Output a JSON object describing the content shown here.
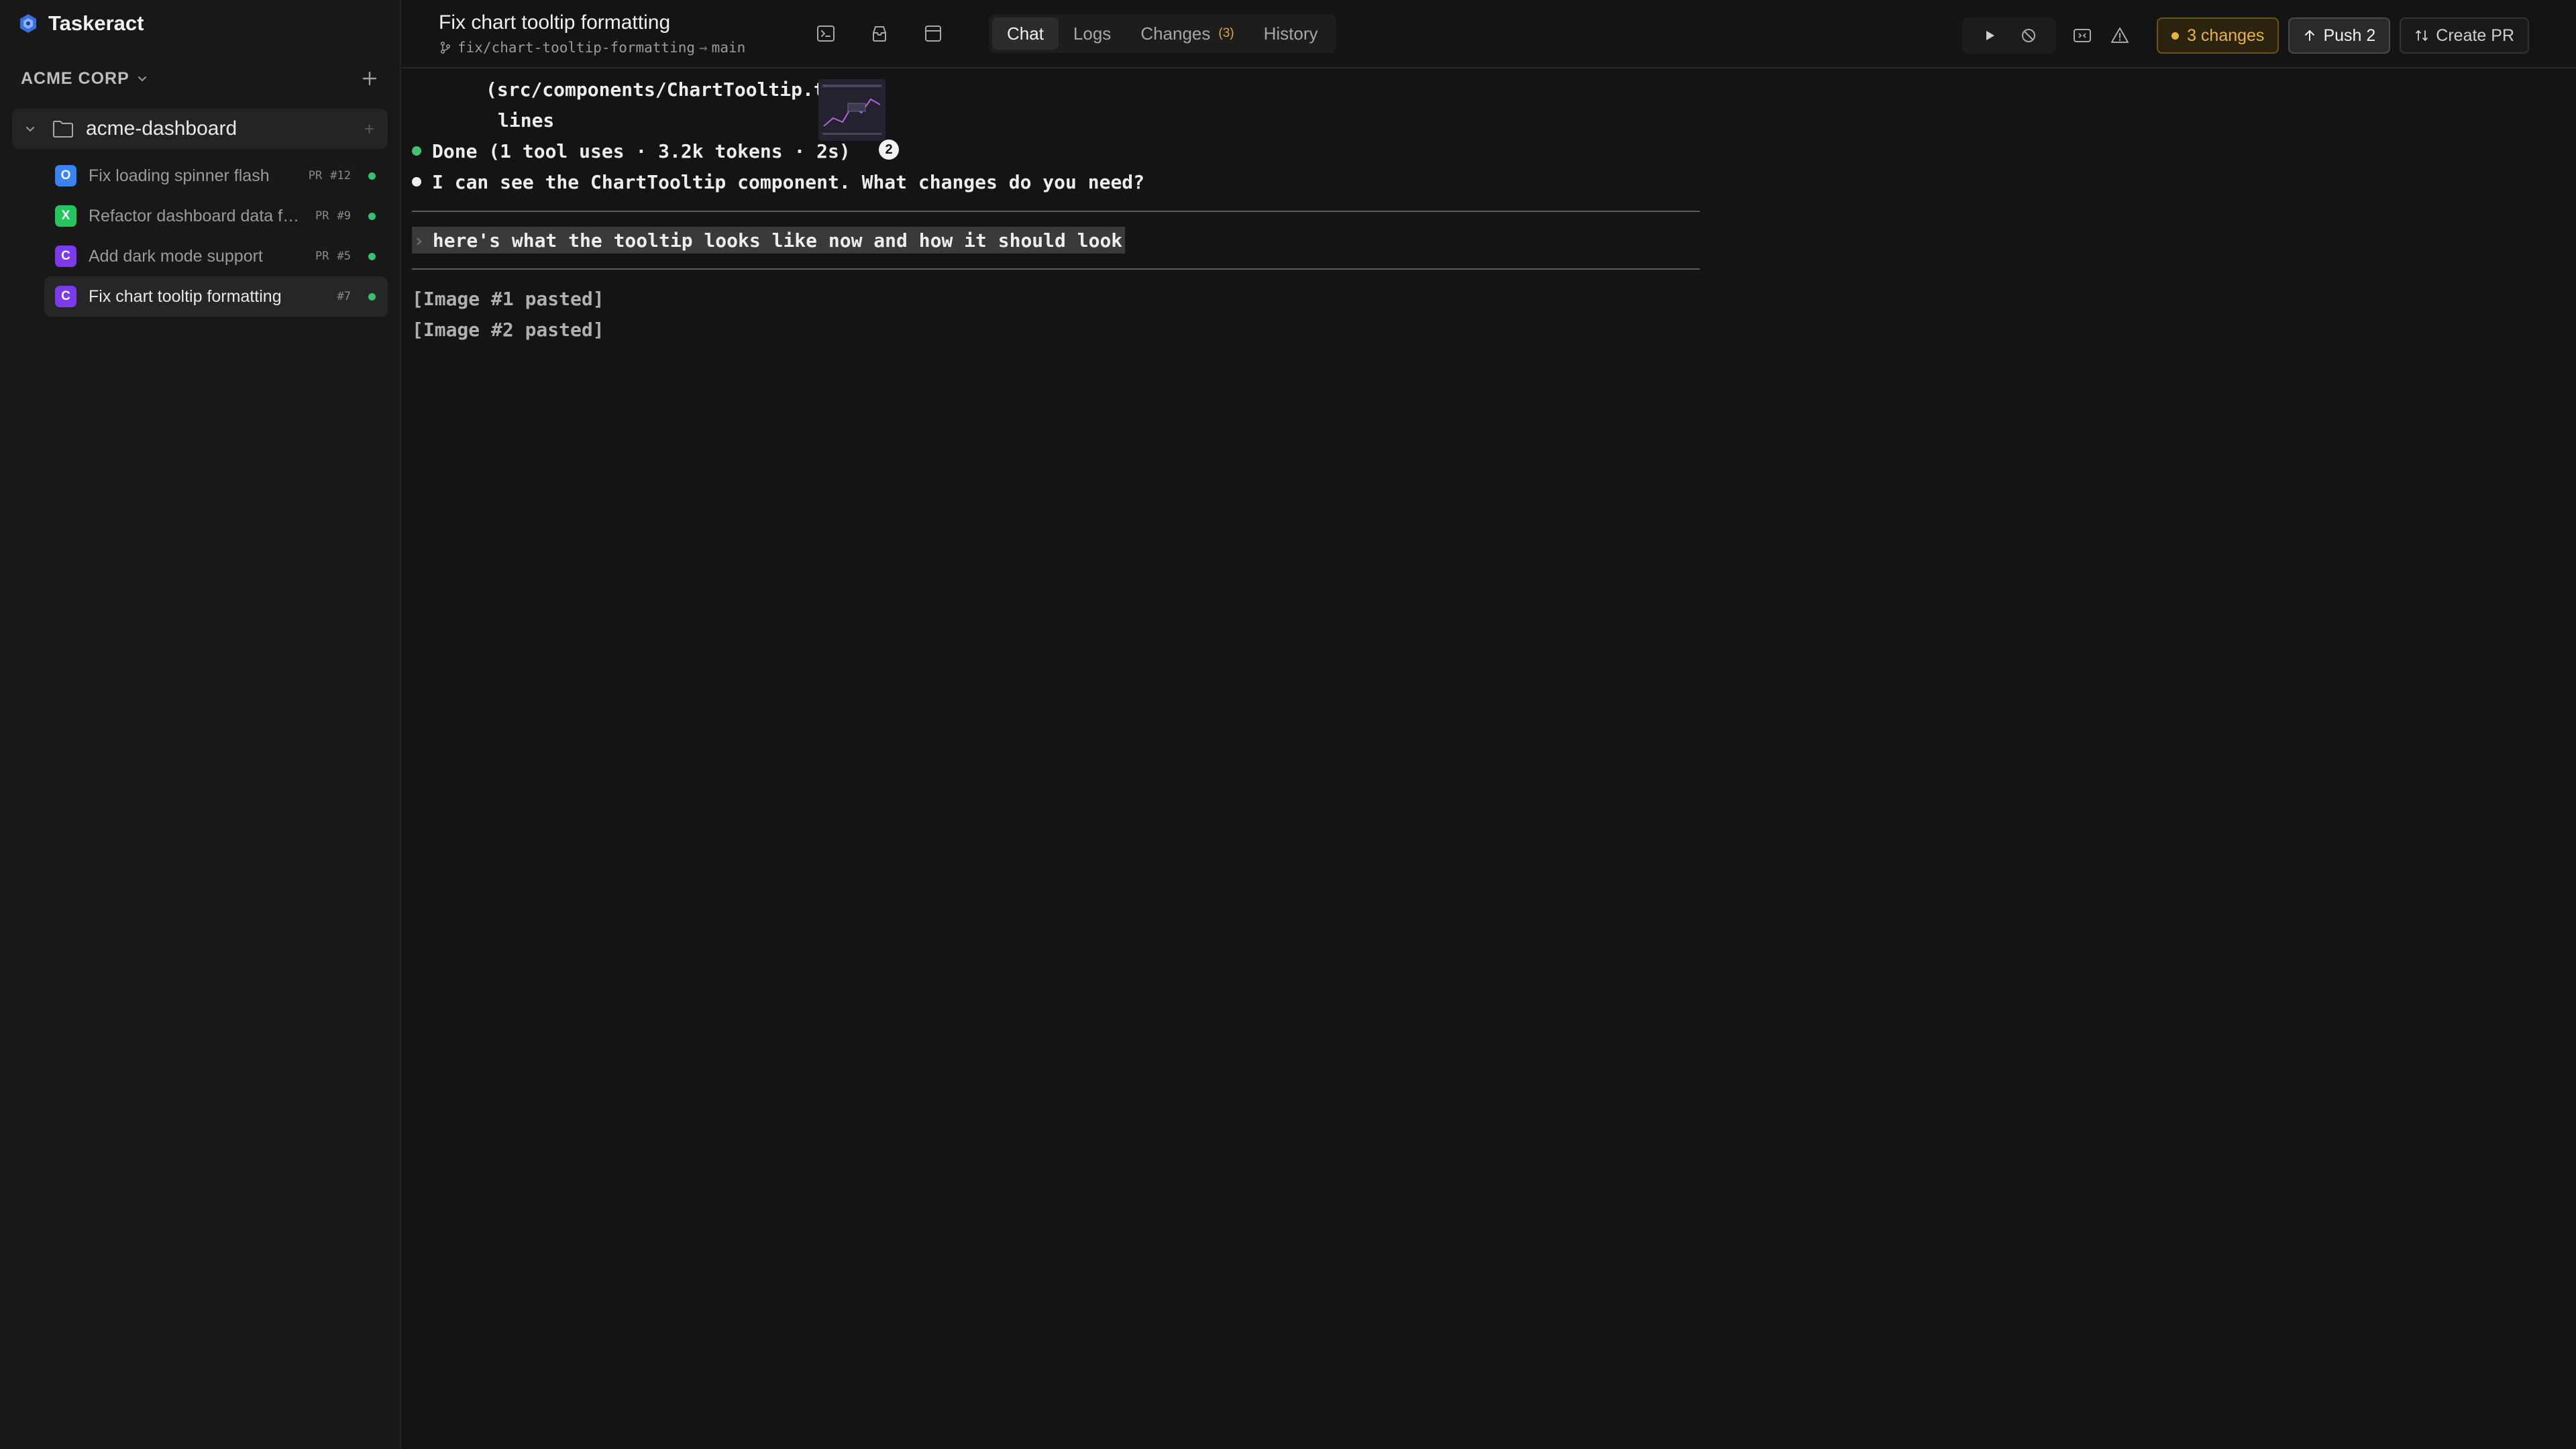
{
  "app": {
    "name": "Taskeract"
  },
  "sidebar": {
    "org_name": "ACME CORP",
    "repo": {
      "name": "acme-dashboard",
      "add_label": "+"
    },
    "tasks": [
      {
        "badge": "O",
        "badge_color": "#3b82f6",
        "title": "Fix loading spinner flash",
        "pr_label": "PR",
        "number": "#12",
        "status_color": "#36c26b"
      },
      {
        "badge": "X",
        "badge_color": "#22c55e",
        "title": "Refactor dashboard data fetching",
        "pr_label": "PR",
        "number": "#9",
        "status_color": "#36c26b"
      },
      {
        "badge": "C",
        "badge_color": "#7c3aed",
        "title": "Add dark mode support",
        "pr_label": "PR",
        "number": "#5",
        "status_color": "#36c26b"
      },
      {
        "badge": "C",
        "badge_color": "#7c3aed",
        "title": "Fix chart tooltip formatting",
        "pr_label": "",
        "number": "#7",
        "status_color": "#36c26b"
      }
    ]
  },
  "header": {
    "task_title": "Fix chart tooltip formatting",
    "branch": "fix/chart-tooltip-formatting",
    "branch_arrow": "→",
    "base_branch": "main",
    "tool_icons": [
      "terminal-icon",
      "archive-icon",
      "layout-icon"
    ],
    "tabs": [
      {
        "label": "Chat",
        "active": true
      },
      {
        "label": "Logs",
        "active": false
      },
      {
        "label": "Changes",
        "active": false,
        "count": "(3)"
      },
      {
        "label": "History",
        "active": false
      }
    ],
    "controls": {
      "run_icon": "play-icon",
      "stop_icon": "stop-icon",
      "preview_icon": "preview-icon",
      "warning_icon": "warning-icon",
      "changes_label": "3 changes",
      "push_label": "Push 2",
      "create_pr_label": "Create PR"
    }
  },
  "terminal": {
    "lines": [
      {
        "text": "(src/components/ChartTooltip.tsx)"
      },
      {
        "text": "lines"
      },
      {
        "text": "Done (1 tool uses · 3.2k tokens · 2s)"
      },
      {
        "text": "I can see the ChartTooltip component. What changes do you need?"
      }
    ],
    "prompt": "here's what the tooltip looks like now and how it should look",
    "prompt_caret": "›",
    "pasted": [
      "[Image #1 pasted]",
      "[Image #2 pasted]"
    ],
    "thumbnail_count": "2"
  }
}
